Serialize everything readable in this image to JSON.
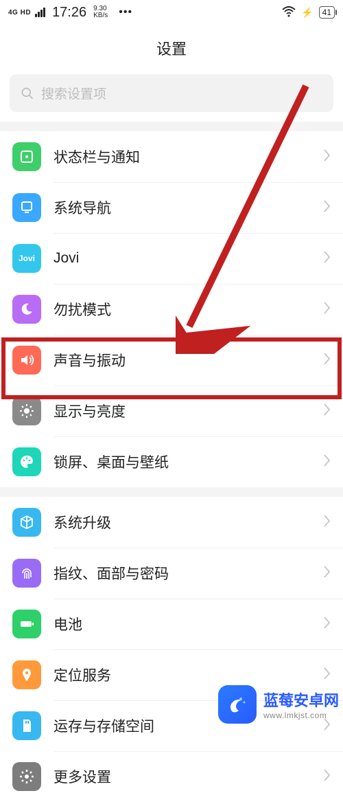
{
  "status": {
    "network_type": "4G HD",
    "time": "17:26",
    "speed_value": "9.30",
    "speed_unit": "KB/s",
    "battery": "41"
  },
  "header": {
    "title": "设置"
  },
  "search": {
    "placeholder": "搜索设置项"
  },
  "group1": [
    {
      "label": "状态栏与通知",
      "icon": "status-bar-icon",
      "bg": "bg-green"
    },
    {
      "label": "系统导航",
      "icon": "navigation-icon",
      "bg": "bg-blue"
    },
    {
      "label": "Jovi",
      "icon": "jovi-icon",
      "bg": "bg-jovi"
    },
    {
      "label": "勿扰模式",
      "icon": "moon-icon",
      "bg": "bg-purple"
    },
    {
      "label": "声音与振动",
      "icon": "speaker-icon",
      "bg": "bg-red"
    },
    {
      "label": "显示与亮度",
      "icon": "brightness-icon",
      "bg": "bg-gray",
      "highlighted": true
    },
    {
      "label": "锁屏、桌面与壁纸",
      "icon": "palette-icon",
      "bg": "bg-teal"
    }
  ],
  "group2": [
    {
      "label": "系统升级",
      "icon": "cube-icon",
      "bg": "bg-cube"
    },
    {
      "label": "指纹、面部与密码",
      "icon": "fingerprint-icon",
      "bg": "bg-finger"
    },
    {
      "label": "电池",
      "icon": "battery-icon",
      "bg": "bg-batt"
    },
    {
      "label": "定位服务",
      "icon": "location-icon",
      "bg": "bg-orange"
    },
    {
      "label": "运存与存储空间",
      "icon": "sdcard-icon",
      "bg": "bg-sd"
    },
    {
      "label": "更多设置",
      "icon": "gear-icon",
      "bg": "bg-gear"
    }
  ],
  "watermark": {
    "title": "蓝莓安卓网",
    "url": "www.lmkjst.com"
  },
  "colors": {
    "highlight": "#c02020",
    "arrow": "#c02020"
  }
}
